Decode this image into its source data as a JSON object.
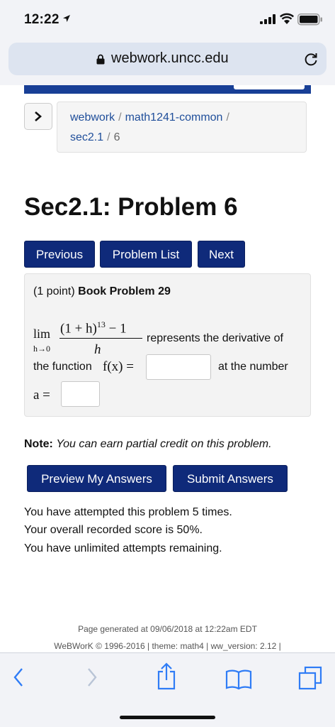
{
  "status": {
    "time": "12:22"
  },
  "browser": {
    "url": "webwork.uncc.edu"
  },
  "breadcrumb": {
    "items": [
      "webwork",
      "math1241-common",
      "sec2.1",
      "6"
    ],
    "separator": "/"
  },
  "page": {
    "title": "Sec2.1: Problem 6"
  },
  "nav_buttons": {
    "previous": "Previous",
    "problem_list": "Problem List",
    "next": "Next"
  },
  "problem": {
    "points": "(1 point)",
    "name": "Book Problem 29",
    "lim": "lim",
    "lim_sub": "h→0",
    "numerator": "(1 + h)",
    "exponent": "13",
    "numerator_tail": " − 1",
    "denominator": "h",
    "represents_text": "represents the derivative of",
    "function_text": "the function",
    "fx": "f(x) =",
    "at_number_text": "at the number",
    "a_eq": "a =",
    "answer1_value": "",
    "answer2_value": ""
  },
  "note": {
    "label": "Note:",
    "text": "You can earn partial credit on this problem."
  },
  "actions": {
    "preview": "Preview My Answers",
    "submit": "Submit Answers"
  },
  "attempts": {
    "line1": "You have attempted this problem 5 times.",
    "line2": "Your overall recorded score is 50%.",
    "line3": "You have unlimited attempts remaining."
  },
  "footer": {
    "generated": "Page generated at 09/06/2018 at 12:22am EDT",
    "copyright": "WeBWorK © 1996-2016 | theme: math4 | ww_version: 2.12 |"
  },
  "colors": {
    "nav_blue": "#183f96",
    "button_blue": "#0f2a7a",
    "link_blue": "#1f4e9a",
    "ios_blue": "#2f7cf6"
  },
  "icons": [
    "location-arrow-icon",
    "signal-icon",
    "wifi-icon",
    "battery-icon",
    "lock-icon",
    "reload-icon",
    "chevron-right-icon",
    "back-icon",
    "forward-icon",
    "share-icon",
    "bookmarks-icon",
    "tabs-icon"
  ]
}
